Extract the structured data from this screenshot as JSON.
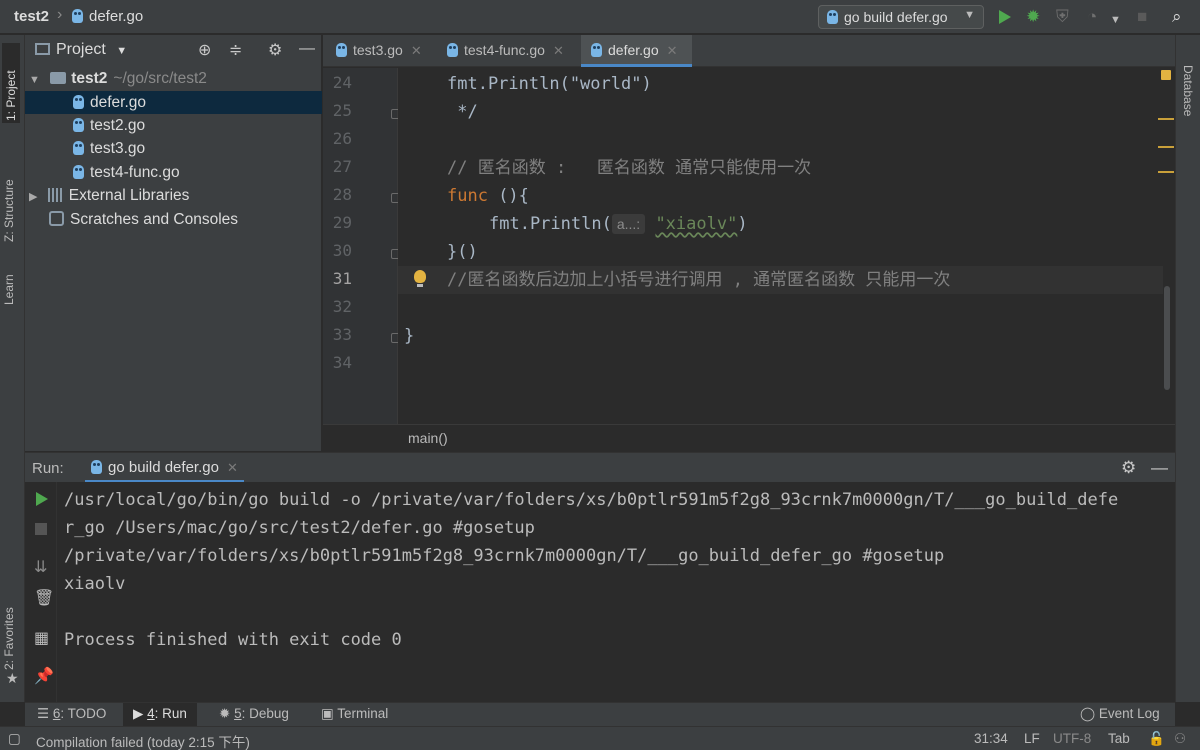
{
  "breadcrumb": {
    "project": "test2",
    "file": "defer.go"
  },
  "run_config": {
    "label": "go build defer.go"
  },
  "left_stripe": [
    "1: Project",
    "Z: Structure",
    "Learn",
    "2: Favorites"
  ],
  "right_stripe": [
    "Database"
  ],
  "project_panel": {
    "title": "Project",
    "root": {
      "name": "test2",
      "path": "~/go/src/test2"
    },
    "files": [
      "defer.go",
      "test2.go",
      "test3.go",
      "test4-func.go"
    ],
    "extra": [
      "External Libraries",
      "Scratches and Consoles"
    ]
  },
  "editor": {
    "tabs": [
      {
        "label": "test3.go"
      },
      {
        "label": "test4-func.go"
      },
      {
        "label": "defer.go"
      }
    ],
    "line_numbers": [
      "24",
      "25",
      "26",
      "27",
      "28",
      "29",
      "30",
      "31",
      "32",
      "33",
      "34"
    ],
    "code": {
      "l24": "fmt.Println(\"world\")",
      "l25": " */",
      "l27": "// 匿名函数 :   匿名函数 通常只能使用一次",
      "l28_kw": "func",
      "l28_rest": " (){",
      "l29_call": "fmt.Println(",
      "l29_hint": "a...:",
      "l29_str": "\"xiaolv\"",
      "l29_close": ")",
      "l30": "}()",
      "l31": "//匿名函数后边加上小括号进行调用 , 通常匿名函数 只能用一次",
      "l33": "}"
    },
    "breadcrumb": "main()"
  },
  "run_panel": {
    "label": "Run:",
    "tab": "go build defer.go",
    "output": [
      "/usr/local/go/bin/go build -o /private/var/folders/xs/b0ptlr591m5f2g8_93crnk7m0000gn/T/___go_build_defe",
      "r_go /Users/mac/go/src/test2/defer.go #gosetup",
      "/private/var/folders/xs/b0ptlr591m5f2g8_93crnk7m0000gn/T/___go_build_defer_go #gosetup",
      "xiaolv",
      "",
      "Process finished with exit code 0"
    ]
  },
  "bottom_tabs": {
    "todo_num": "6",
    "todo_label": ": TODO",
    "run_num": "4",
    "run_label": ": Run",
    "debug_num": "5",
    "debug_label": ": Debug",
    "terminal": "Terminal",
    "event_log": "Event Log"
  },
  "status": {
    "message": "Compilation failed (today 2:15 下午)",
    "position": "31:34",
    "line_sep": "LF",
    "encoding": "UTF-8",
    "indent": "Tab"
  },
  "colors": {
    "accent": "#4a88c7",
    "run_green": "#4fa84f",
    "keyword": "#cc7832",
    "string": "#6a8759",
    "comment": "#808080",
    "warning": "#e3b341"
  }
}
